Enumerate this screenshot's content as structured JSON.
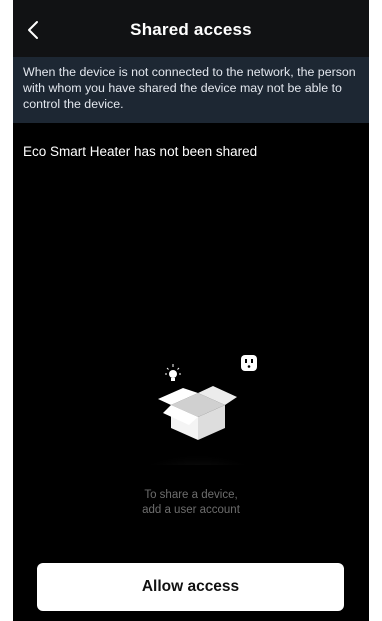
{
  "header": {
    "title": "Shared access",
    "back_icon": "chevron-left-icon"
  },
  "notice": {
    "text": "When the device is not connected to the network, the person with whom you have shared the device may not be able to control the device."
  },
  "status": {
    "text": "Eco Smart Heater has not been shared"
  },
  "empty_state": {
    "icons": [
      "lamp-icon",
      "plug-icon",
      "open-box-icon"
    ],
    "hint_line1": "To share a device,",
    "hint_line2": "add a user account"
  },
  "actions": {
    "allow_label": "Allow access"
  },
  "colors": {
    "background": "#000000",
    "navbar": "#111214",
    "notice_bg": "#1d2733",
    "button_bg": "#ffffff"
  }
}
